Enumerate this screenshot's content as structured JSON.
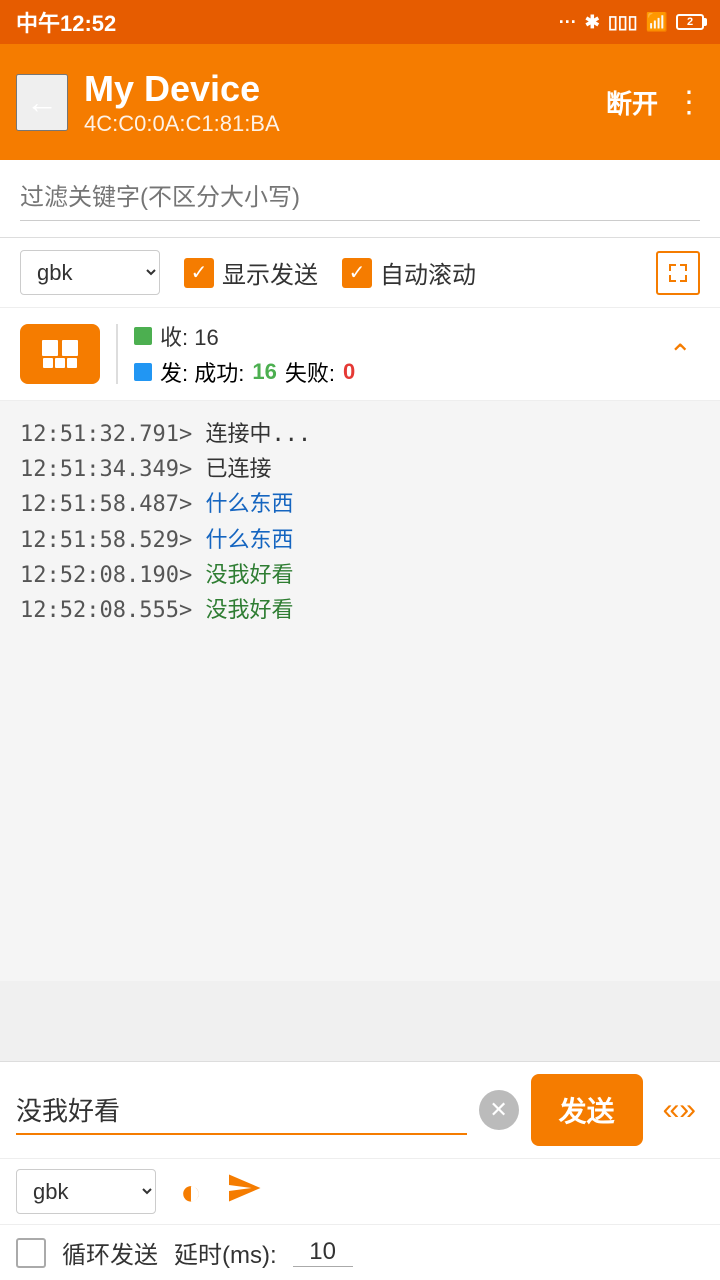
{
  "statusBar": {
    "time": "中午12:52",
    "batteryLevel": "2"
  },
  "appBar": {
    "title": "My Device",
    "subtitle": "4C:C0:0A:C1:81:BA",
    "disconnectLabel": "断开",
    "backIcon": "←",
    "moreIcon": "⋮"
  },
  "filter": {
    "placeholder": "过滤关键字(不区分大小写)"
  },
  "controls": {
    "encoding": "gbk",
    "showSendLabel": "显示发送",
    "autoScrollLabel": "自动滚动"
  },
  "stats": {
    "recvLabel": "收: 16",
    "sendSuccessLabel": "发: 成功: 16",
    "sendFailLabel": "失败: 0"
  },
  "log": {
    "lines": [
      {
        "time": "12:51:32.791>",
        "message": " 连接中...",
        "style": "default"
      },
      {
        "time": "12:51:34.349>",
        "message": " 已连接",
        "style": "default"
      },
      {
        "time": "12:51:58.487>",
        "message": " 什么东西",
        "style": "blue"
      },
      {
        "time": "12:51:58.529>",
        "message": " 什么东西",
        "style": "blue"
      },
      {
        "time": "12:52:08.190>",
        "message": " 没我好看",
        "style": "green"
      },
      {
        "time": "12:52:08.555>",
        "message": " 没我好看",
        "style": "green"
      }
    ]
  },
  "sendInput": {
    "value": "没我好看",
    "sendLabel": "发送"
  },
  "bottomControls": {
    "encoding": "gbk"
  },
  "loopRow": {
    "label": "循环发送",
    "delayLabel": "延时(ms):",
    "delayValue": "10"
  }
}
